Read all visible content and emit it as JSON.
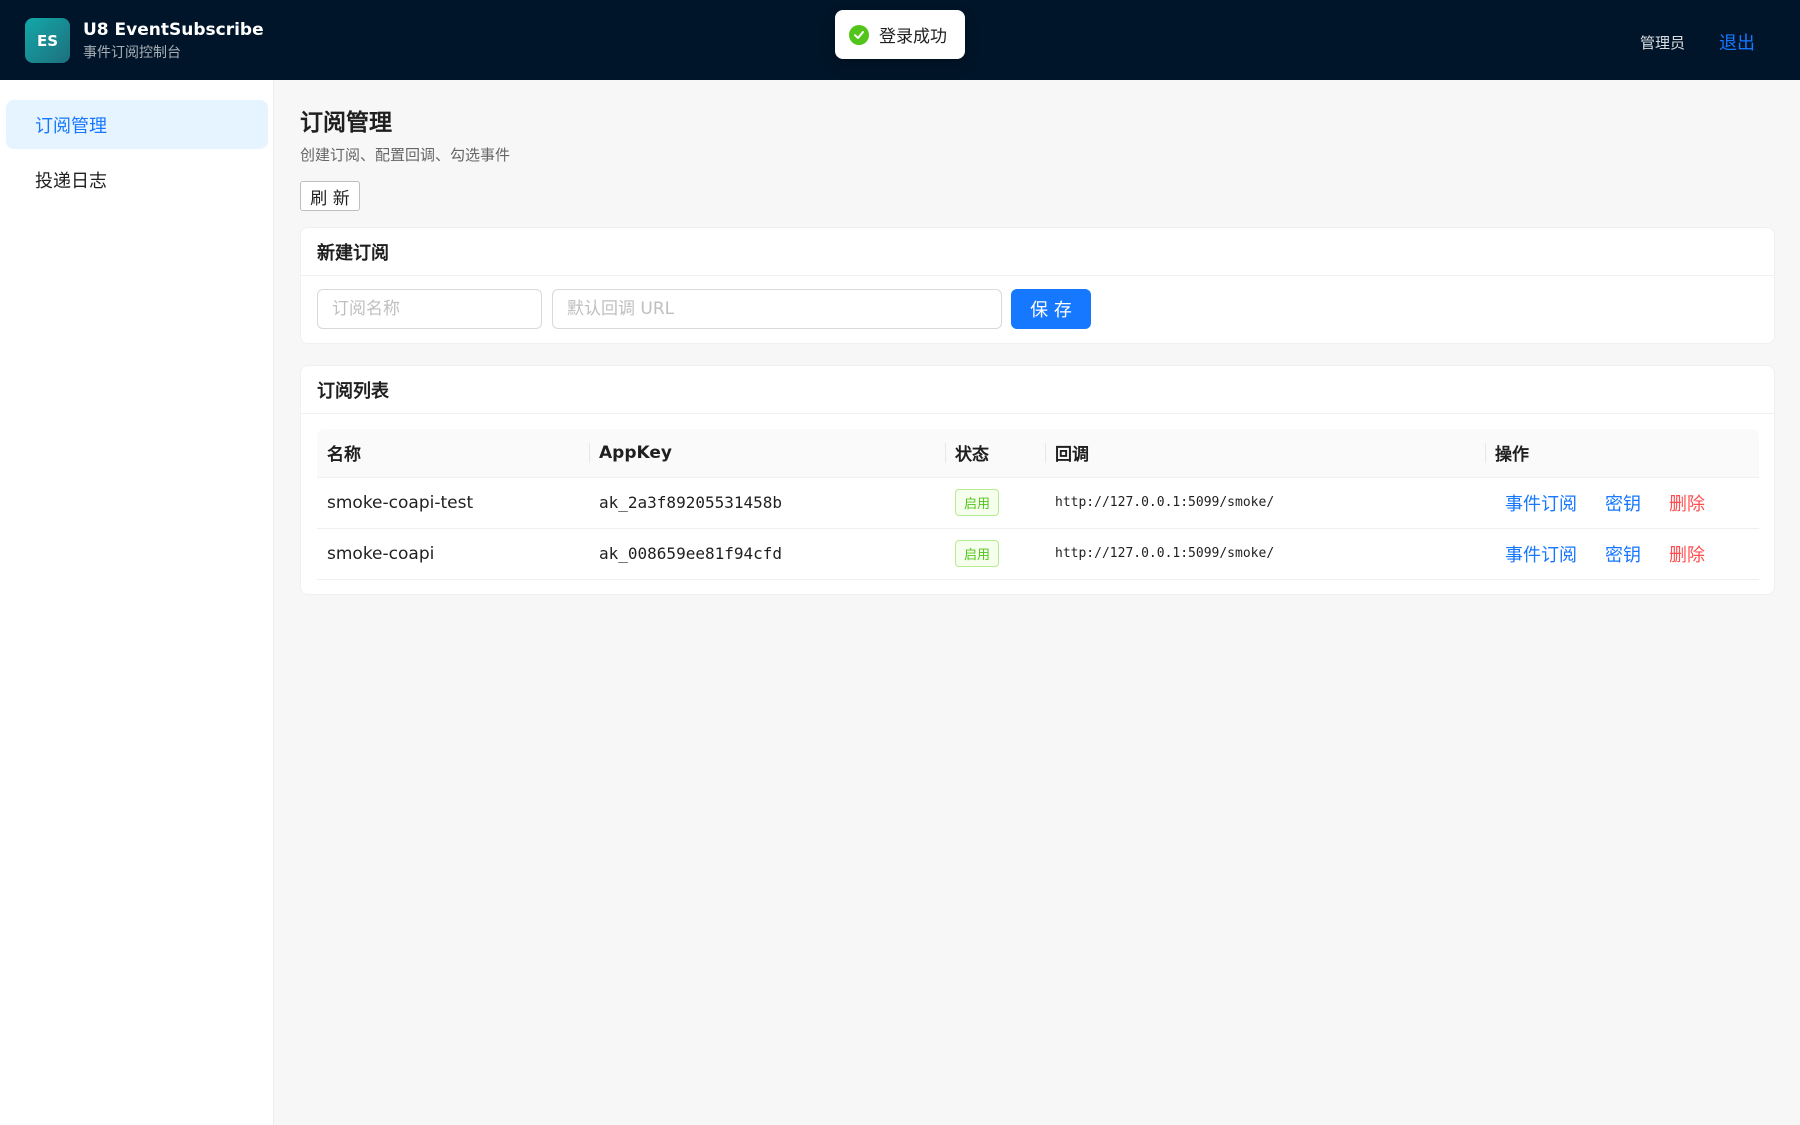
{
  "header": {
    "logo_text": "ES",
    "title": "U8 EventSubscribe",
    "subtitle": "事件订阅控制台",
    "user": "管理员",
    "logout_label": "退出"
  },
  "toast": {
    "message": "登录成功",
    "type": "success"
  },
  "sidebar": {
    "items": [
      {
        "label": "订阅管理",
        "active": true
      },
      {
        "label": "投递日志",
        "active": false
      }
    ]
  },
  "main": {
    "title": "订阅管理",
    "subtitle": "创建订阅、配置回调、勾选事件",
    "refresh_label": "刷 新",
    "new_subscription": {
      "title": "新建订阅",
      "name_placeholder": "订阅名称",
      "url_placeholder": "默认回调 URL",
      "save_label": "保 存"
    },
    "list": {
      "title": "订阅列表",
      "columns": [
        "名称",
        "AppKey",
        "状态",
        "回调",
        "操作"
      ],
      "rows": [
        {
          "name": "smoke-coapi-test",
          "appkey": "ak_2a3f89205531458b",
          "status": "启用",
          "callback": "http://127.0.0.1:5099/smoke/",
          "actions": [
            "事件订阅",
            "密钥",
            "删除"
          ]
        },
        {
          "name": "smoke-coapi",
          "appkey": "ak_008659ee81f94cfd",
          "status": "启用",
          "callback": "http://127.0.0.1:5099/smoke/",
          "actions": [
            "事件订阅",
            "密钥",
            "删除"
          ]
        }
      ]
    }
  },
  "colors": {
    "header_bg": "#001529",
    "primary": "#1677ff",
    "danger": "#ff4d4f",
    "success": "#52c41a"
  }
}
